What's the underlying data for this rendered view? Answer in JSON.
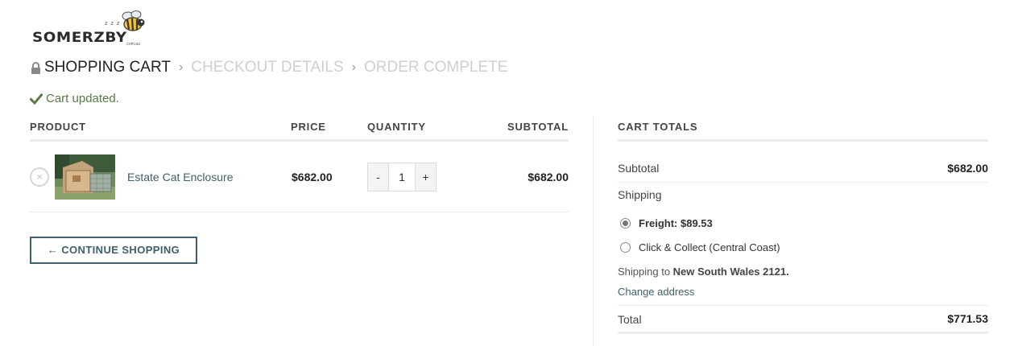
{
  "logo": {
    "text": "SOMERZBY",
    "tld": ".com.au",
    "zzz": "z z z"
  },
  "breadcrumb": [
    {
      "label": "SHOPPING CART",
      "active": true
    },
    {
      "label": "CHECKOUT DETAILS",
      "active": false
    },
    {
      "label": "ORDER COMPLETE",
      "active": false
    }
  ],
  "breadcrumb_sep": "›",
  "notice": {
    "text": "Cart updated."
  },
  "cart": {
    "headers": {
      "product": "PRODUCT",
      "price": "PRICE",
      "quantity": "QUANTITY",
      "subtotal": "SUBTOTAL"
    },
    "items": [
      {
        "remove": "×",
        "name": "Estate Cat Enclosure",
        "price": "$682.00",
        "quantity": "1",
        "subtotal": "$682.00",
        "minus": "-",
        "plus": "+"
      }
    ],
    "continue_label": "← CONTINUE SHOPPING"
  },
  "totals": {
    "title": "CART TOTALS",
    "subtotal_label": "Subtotal",
    "subtotal_value": "$682.00",
    "shipping_label": "Shipping",
    "options": [
      {
        "label": "Freight: $89.53",
        "selected": true
      },
      {
        "label": "Click & Collect (Central Coast)",
        "selected": false
      }
    ],
    "ship_to_prefix": "Shipping to ",
    "ship_to_location": "New South Wales 2121.",
    "change_address": "Change address",
    "total_label": "Total",
    "total_value": "$771.53"
  },
  "colors": {
    "accent": "#3f5f6c",
    "success": "#5b7a46",
    "inactive": "#cfcfcf"
  }
}
